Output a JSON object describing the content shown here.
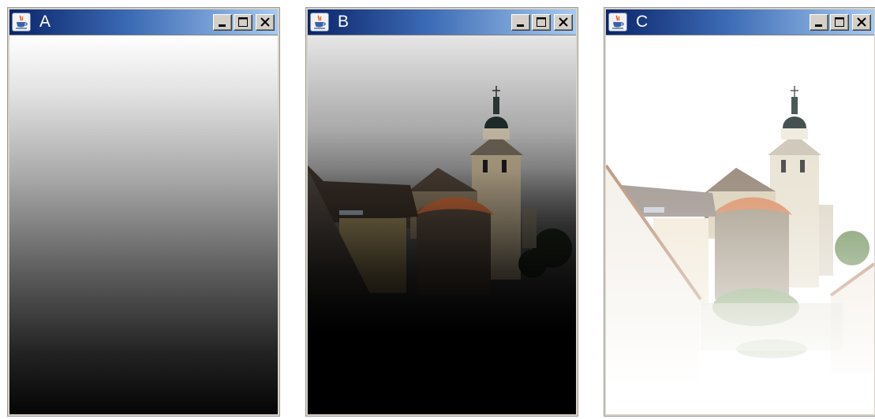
{
  "windows": [
    {
      "title": "A",
      "icon": "java-cup-icon",
      "controls": [
        "minimize-icon",
        "maximize-icon",
        "close-icon"
      ],
      "content": "vertical-gradient-white-to-black"
    },
    {
      "title": "B",
      "icon": "java-cup-icon",
      "controls": [
        "minimize-icon",
        "maximize-icon",
        "close-icon"
      ],
      "content": "church-photo-darkened-toward-bottom"
    },
    {
      "title": "C",
      "icon": "java-cup-icon",
      "controls": [
        "minimize-icon",
        "maximize-icon",
        "close-icon"
      ],
      "content": "church-photo-faded-to-white-toward-bottom"
    }
  ],
  "colors": {
    "titlebar_start": "#0a246a",
    "titlebar_end": "#a6caf0",
    "window_frame": "#d4d0c8",
    "title_text": "#ffffff"
  }
}
